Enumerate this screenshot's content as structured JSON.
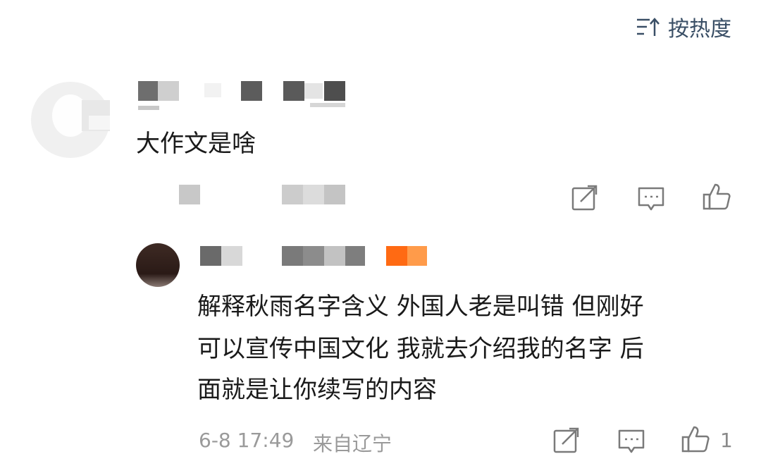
{
  "sort": {
    "label": "按热度",
    "icon": "sort-icon"
  },
  "comment": {
    "text": "大作文是啥",
    "actions": {
      "repost_icon": "repost-icon",
      "reply_icon": "comment-icon",
      "like_icon": "thumbs-up-icon"
    }
  },
  "reply": {
    "lines": [
      "解释秋雨名字含义 外国人老是叫错 但刚好",
      "可以宣传中国文化 我就去介绍我的名字 后",
      "面就是让你续写的内容"
    ],
    "timestamp": "6-8 17:49",
    "location": "来自辽宁",
    "like_count": "1",
    "actions": {
      "repost_icon": "repost-icon",
      "reply_icon": "comment-icon",
      "like_icon": "thumbs-up-icon"
    }
  },
  "colors": {
    "sort_text": "#3a4f66",
    "icon_stroke": "#7a7a7a",
    "meta_text": "#9a9a9a",
    "badge_orange": "#ff6a13"
  }
}
